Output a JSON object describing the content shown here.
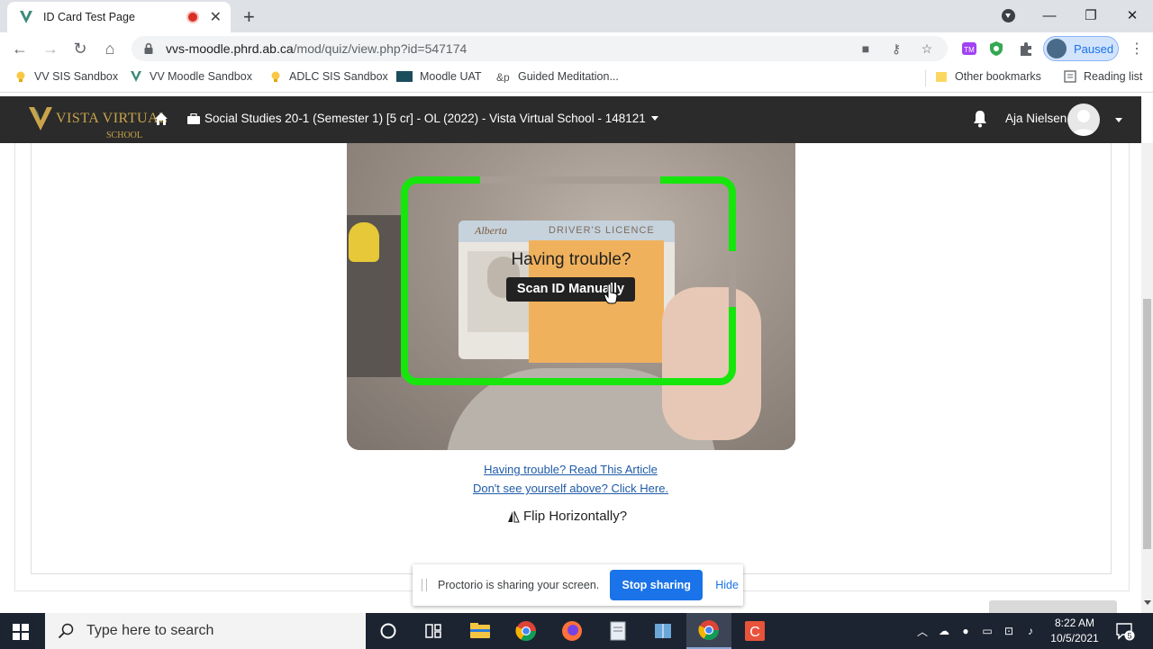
{
  "browser": {
    "tab_title": "ID Card Test Page",
    "tab_close": "✕",
    "new_tab": "+",
    "url_host": "vvs-moodle.phrd.ab.ca",
    "url_path": "/mod/quiz/view.php?id=547174",
    "profile_status": "Paused",
    "window_controls": {
      "minimize": "—",
      "restore": "❐",
      "close": "✕"
    }
  },
  "bookmarks": [
    {
      "label": "VV SIS Sandbox",
      "icon": "lightbulb-icon"
    },
    {
      "label": "VV Moodle Sandbox",
      "icon": "vista-v-icon"
    },
    {
      "label": "ADLC SIS Sandbox",
      "icon": "lightbulb-icon"
    },
    {
      "label": "Moodle UAT",
      "icon": "adlc-icon"
    },
    {
      "label": "Guided Meditation...",
      "icon": "meditation-icon"
    }
  ],
  "bookmarks_right": {
    "other": "Other bookmarks",
    "reading": "Reading list"
  },
  "moodle": {
    "logo_text": "VISTA VIRTUAL",
    "logo_sub": "SCHOOL",
    "course": "Social Studies 20-1 (Semester 1) [5 cr] - OL (2022) - Vista Virtual School - 148121",
    "user_name": "Aja Nielsen"
  },
  "scanner": {
    "id_province": "Alberta",
    "id_type": "DRIVER'S LICENCE",
    "trouble_text": "Having trouble?",
    "scan_button": "Scan ID Manually",
    "link_article": "Having trouble? Read This Article",
    "link_click_here": "Don't see yourself above? Click Here.",
    "flip": "Flip Horizontally?"
  },
  "share_bar": {
    "message": "Proctorio is sharing your screen.",
    "stop": "Stop sharing",
    "hide": "Hide"
  },
  "taskbar": {
    "search_placeholder": "Type here to search",
    "time": "8:22 AM",
    "date": "10/5/2021",
    "notification_count": "5"
  },
  "colors": {
    "scan_frame": "#17e60d",
    "moodle_nav": "#2b2b2b",
    "link": "#1f5ba7",
    "stop_button": "#1a73e8"
  }
}
